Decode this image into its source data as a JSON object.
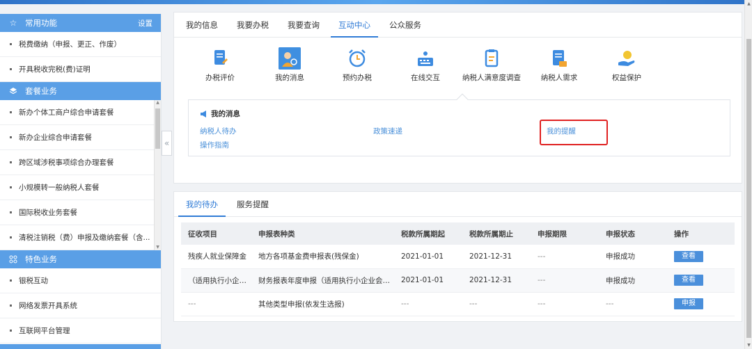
{
  "sidebar": {
    "common": {
      "title": "常用功能",
      "settings": "设置",
      "items": [
        "税费缴纳（申报、更正、作废）",
        "开具税收完税(费)证明"
      ]
    },
    "package": {
      "title": "套餐业务",
      "items": [
        "新办个体工商户综合申请套餐",
        "新办企业综合申请套餐",
        "跨区域涉税事项综合办理套餐",
        "小规模转一般纳税人套餐",
        "国际税收业务套餐",
        "清税注销税（费）申报及缴纳套餐（含..."
      ]
    },
    "special": {
      "title": "特色业务",
      "items": [
        "银税互动",
        "网络发票开具系统",
        "互联网平台管理"
      ]
    }
  },
  "main_tabs": [
    "我的信息",
    "我要办税",
    "我要查询",
    "互动中心",
    "公众服务"
  ],
  "active_tab": "互动中心",
  "icon_buttons": [
    "办税评价",
    "我的消息",
    "预约办税",
    "在线交互",
    "纳税人满意度调查",
    "纳税人需求",
    "权益保护"
  ],
  "message_box": {
    "title": "我的消息",
    "links": [
      "纳税人待办",
      "政策速递",
      "我的提醒",
      "操作指南"
    ]
  },
  "todo_tabs": [
    "我的待办",
    "服务提醒"
  ],
  "table": {
    "headers": [
      "征收项目",
      "申报表种类",
      "税款所属期起",
      "税款所属期止",
      "申报期限",
      "申报状态",
      "操作"
    ],
    "rows": [
      [
        "残疾人就业保障金",
        "地方各项基金费申报表(残保金)",
        "2021-01-01",
        "2021-12-31",
        "---",
        "申报成功",
        "查看"
      ],
      [
        "（适用执行小企业...",
        "财务报表年度申报（适用执行小企业会计准...",
        "2021-01-01",
        "2021-12-31",
        "---",
        "申报成功",
        "查看"
      ],
      [
        "---",
        "其他类型申报(依发生选报)",
        "---",
        "---",
        "---",
        "---",
        "申报"
      ]
    ]
  },
  "colors": {
    "accent": "#2f7bd6",
    "sidebar_header": "#5a9fe6",
    "highlight_box": "#e02020"
  }
}
